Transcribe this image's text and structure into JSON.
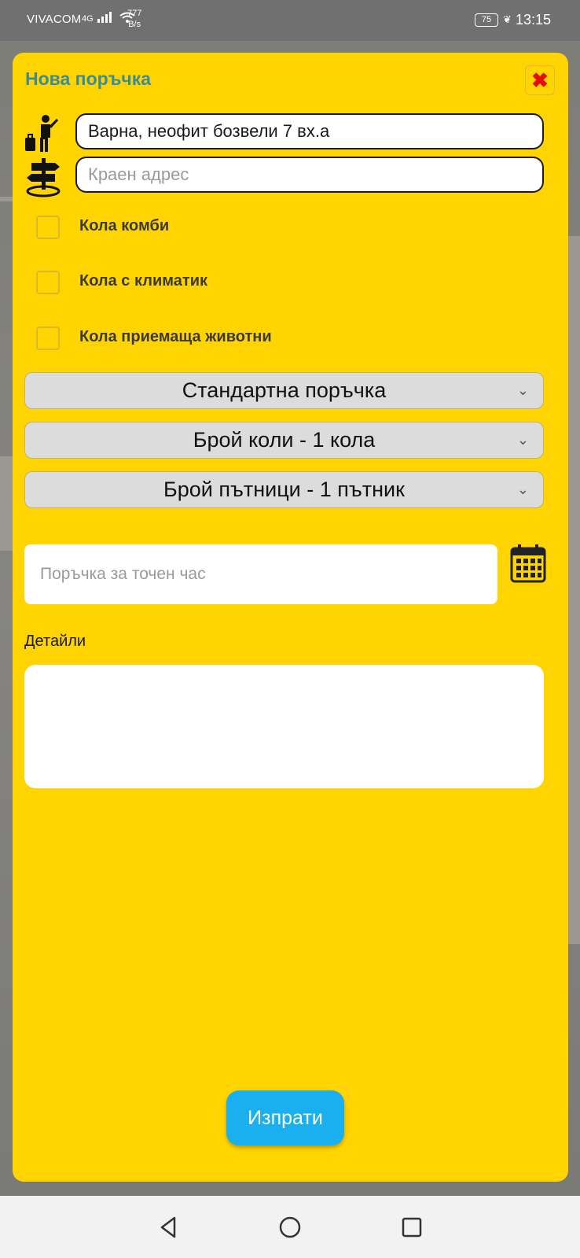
{
  "status_bar": {
    "carrier": "VIVACOM",
    "network": "4G",
    "speed_value": "777",
    "speed_unit": "B/s",
    "battery": "75",
    "time": "13:15"
  },
  "modal": {
    "title": "Нова поръчка",
    "close_label": "✖",
    "pickup_address": "Варна, неофит бозвели 7 вх.а",
    "destination_placeholder": "Краен адрес",
    "options": [
      {
        "label": "Кола комби",
        "checked": false
      },
      {
        "label": "Кола с климатик",
        "checked": false
      },
      {
        "label": "Кола приемаща животни",
        "checked": false
      }
    ],
    "dropdowns": [
      {
        "value": "Стандартна поръчка"
      },
      {
        "value": "Брой коли - 1 кола"
      },
      {
        "value": "Брой пътници - 1 пътник"
      }
    ],
    "scheduled_time_placeholder": "Поръчка за точен час",
    "details_label": "Детайли",
    "details_value": "",
    "send_label": "Изпрати"
  },
  "colors": {
    "modal_background": "#ffd400",
    "title": "#3b8c96",
    "close": "#e01010",
    "send_button": "#1ab0f0"
  },
  "icons": {
    "pickup": "hitchhiker-with-luggage-icon",
    "destination": "signpost-icon",
    "calendar": "calendar-icon",
    "close": "close-icon",
    "nav_back": "back-triangle-icon",
    "nav_home": "home-circle-icon",
    "nav_recents": "recents-square-icon"
  }
}
